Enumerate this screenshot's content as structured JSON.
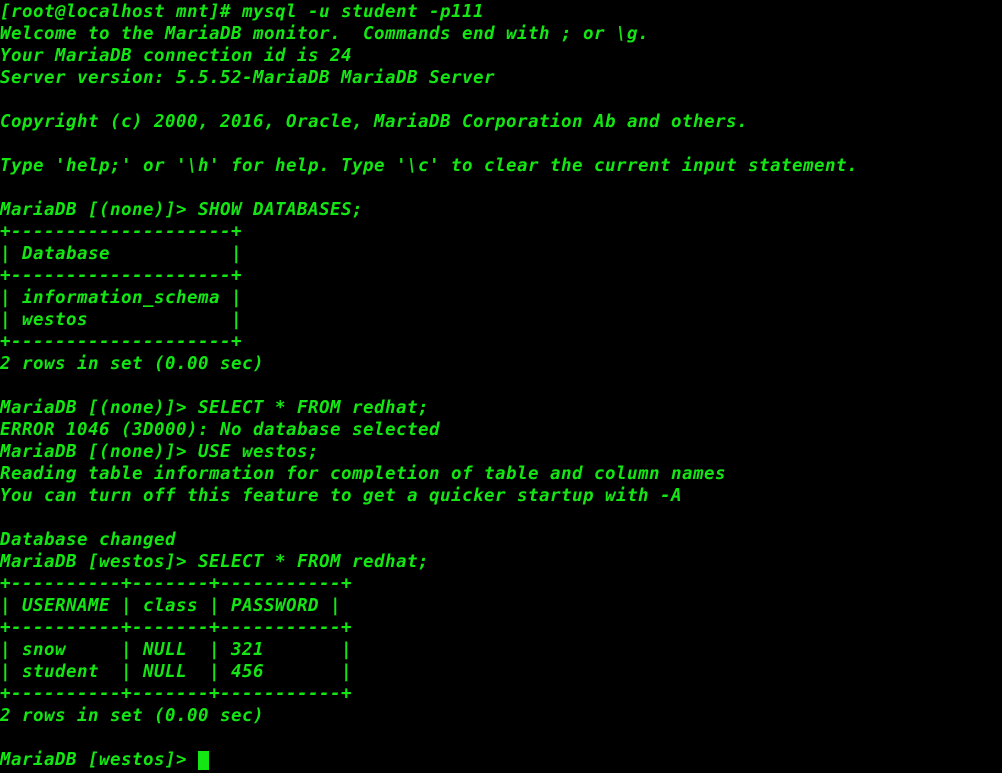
{
  "terminal": {
    "colors": {
      "background": "#000000",
      "foreground": "#13e613",
      "cursor": "#13e613"
    },
    "cursor": {
      "shape": "block",
      "visible": true
    },
    "lines": [
      "[root@localhost mnt]# mysql -u student -p111",
      "Welcome to the MariaDB monitor.  Commands end with ; or \\g.",
      "Your MariaDB connection id is 24",
      "Server version: 5.5.52-MariaDB MariaDB Server",
      "",
      "Copyright (c) 2000, 2016, Oracle, MariaDB Corporation Ab and others.",
      "",
      "Type 'help;' or '\\h' for help. Type '\\c' to clear the current input statement.",
      "",
      "MariaDB [(none)]> SHOW DATABASES;",
      "+--------------------+",
      "| Database           |",
      "+--------------------+",
      "| information_schema |",
      "| westos             |",
      "+--------------------+",
      "2 rows in set (0.00 sec)",
      "",
      "MariaDB [(none)]> SELECT * FROM redhat;",
      "ERROR 1046 (3D000): No database selected",
      "MariaDB [(none)]> USE westos;",
      "Reading table information for completion of table and column names",
      "You can turn off this feature to get a quicker startup with -A",
      "",
      "Database changed",
      "MariaDB [westos]> SELECT * FROM redhat;",
      "+----------+-------+-----------+",
      "| USERNAME | class | PASSWORD |",
      "+----------+-------+-----------+",
      "| snow     | NULL  | 321       |",
      "| student  | NULL  | 456       |",
      "+----------+-------+-----------+",
      "2 rows in set (0.00 sec)",
      ""
    ],
    "final_prompt": "MariaDB [westos]> ",
    "shell_prompt": "[root@localhost mnt]#",
    "command_entered": "mysql -u student -p111",
    "server": {
      "version": "5.5.52-MariaDB MariaDB Server",
      "connection_id": "24",
      "copyright": "Copyright (c) 2000, 2016, Oracle, MariaDB Corporation Ab and others."
    },
    "databases": {
      "header": "Database",
      "rows": [
        "information_schema",
        "westos"
      ],
      "row_count_text": "2 rows in set (0.00 sec)"
    },
    "redhat_table": {
      "headers": [
        "USERNAME",
        "class",
        "PASSWORD"
      ],
      "rows": [
        [
          "snow",
          "NULL",
          "321"
        ],
        [
          "student",
          "NULL",
          "456"
        ]
      ],
      "row_count_text": "2 rows in set (0.00 sec)"
    },
    "messages": {
      "error": "ERROR 1046 (3D000): No database selected",
      "reading_tables": "Reading table information for completion of table and column names",
      "turn_off_hint": "You can turn off this feature to get a quicker startup with -A",
      "database_changed": "Database changed"
    }
  }
}
